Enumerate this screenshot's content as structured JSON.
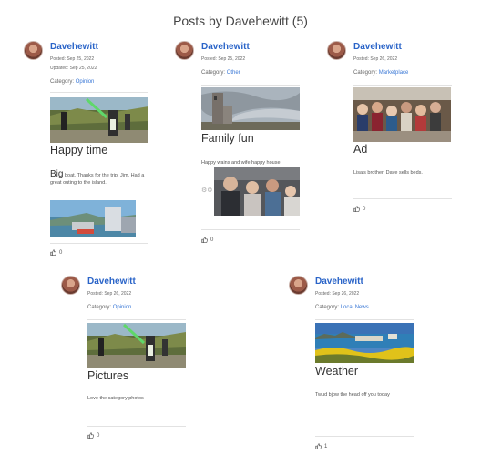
{
  "page": {
    "title": "Posts by Davehewitt (5)"
  },
  "posts": [
    {
      "author": "Davehewitt",
      "posted": "Posted: Sep 25, 2022",
      "updated": "Updated: Sep 25, 2022",
      "category_label": "Category:",
      "category": "Opinion",
      "title": "Happy time",
      "body_lead": "Big",
      "body": "boat. Thanks for the trip, Jim. Had a great outing to the island.",
      "likes": "0"
    },
    {
      "author": "Davehewitt",
      "posted": "Posted: Sep 25, 2022",
      "category_label": "Category:",
      "category": "Other",
      "title": "Family fun",
      "body": "Happy wains and wife happy house",
      "likes": "0"
    },
    {
      "author": "Davehewitt",
      "posted": "Posted: Sep 26, 2022",
      "category_label": "Category:",
      "category": "Marketplace",
      "title": "Ad",
      "body": "Lisa's brother, Dave sells beds.",
      "likes": "0"
    },
    {
      "author": "Davehewitt",
      "posted": "Posted: Sep 26, 2022",
      "category_label": "Category:",
      "category": "Opinion",
      "title": "Pictures",
      "body": "Love the category photos",
      "likes": "0"
    },
    {
      "author": "Davehewitt",
      "posted": "Posted: Sep 26, 2022",
      "category_label": "Category:",
      "category": "Local News",
      "title": "Weather",
      "body": "Twud bjow the head off you today",
      "likes": "1"
    }
  ]
}
